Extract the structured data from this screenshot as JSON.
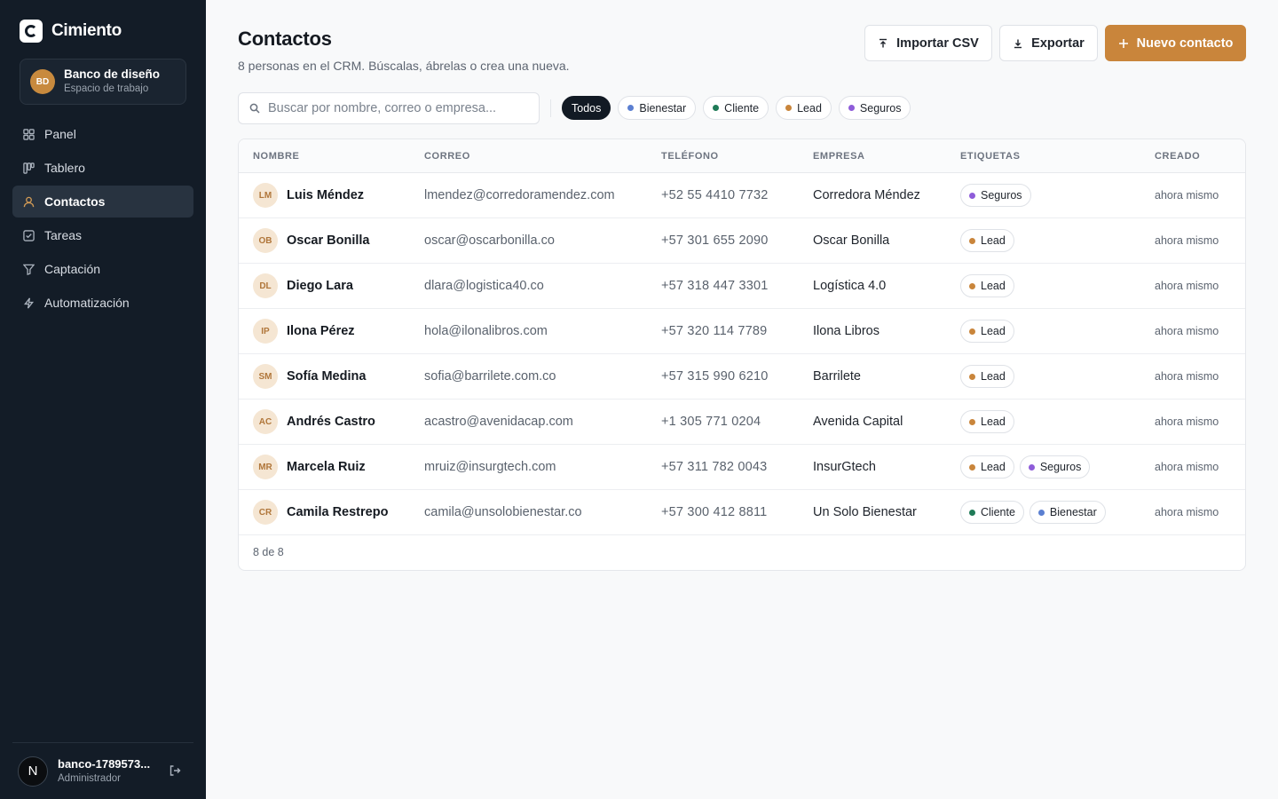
{
  "brand": {
    "name": "Cimiento"
  },
  "workspace": {
    "initials": "BD",
    "name": "Banco de diseño",
    "subtitle": "Espacio de trabajo"
  },
  "nav": [
    {
      "label": "Panel",
      "icon": "grid-icon",
      "active": false
    },
    {
      "label": "Tablero",
      "icon": "kanban-icon",
      "active": false
    },
    {
      "label": "Contactos",
      "icon": "user-icon",
      "active": true
    },
    {
      "label": "Tareas",
      "icon": "checkbox-icon",
      "active": false
    },
    {
      "label": "Captación",
      "icon": "funnel-icon",
      "active": false
    },
    {
      "label": "Automatización",
      "icon": "bolt-icon",
      "active": false
    }
  ],
  "user": {
    "avatar_letter": "N",
    "name": "banco-1789573...",
    "role": "Administrador"
  },
  "header": {
    "title": "Contactos",
    "subtitle": "8 personas en el CRM. Búscalas, ábrelas o crea una nueva.",
    "import_label": "Importar CSV",
    "export_label": "Exportar",
    "new_label": "Nuevo contacto"
  },
  "search": {
    "placeholder": "Buscar por nombre, correo o empresa...",
    "value": ""
  },
  "filters": [
    {
      "label": "Todos",
      "active": true,
      "color": ""
    },
    {
      "label": "Bienestar",
      "active": false,
      "color": "#5b7fd1"
    },
    {
      "label": "Cliente",
      "active": false,
      "color": "#1f7a57"
    },
    {
      "label": "Lead",
      "active": false,
      "color": "#c9853b"
    },
    {
      "label": "Seguros",
      "active": false,
      "color": "#8e5cd9"
    }
  ],
  "table": {
    "columns": [
      "NOMBRE",
      "CORREO",
      "TELÉFONO",
      "EMPRESA",
      "ETIQUETAS",
      "CREADO"
    ],
    "rows": [
      {
        "initials": "LM",
        "name": "Luis Méndez",
        "email": "lmendez@corredoramendez.com",
        "phone": "+52 55 4410 7732",
        "company": "Corredora Méndez",
        "tags": [
          "Seguros"
        ],
        "created": "ahora mismo"
      },
      {
        "initials": "OB",
        "name": "Oscar Bonilla",
        "email": "oscar@oscarbonilla.co",
        "phone": "+57 301 655 2090",
        "company": "Oscar Bonilla",
        "tags": [
          "Lead"
        ],
        "created": "ahora mismo"
      },
      {
        "initials": "DL",
        "name": "Diego Lara",
        "email": "dlara@logistica40.co",
        "phone": "+57 318 447 3301",
        "company": "Logística 4.0",
        "tags": [
          "Lead"
        ],
        "created": "ahora mismo"
      },
      {
        "initials": "IP",
        "name": "Ilona Pérez",
        "email": "hola@ilonalibros.com",
        "phone": "+57 320 114 7789",
        "company": "Ilona Libros",
        "tags": [
          "Lead"
        ],
        "created": "ahora mismo"
      },
      {
        "initials": "SM",
        "name": "Sofía Medina",
        "email": "sofia@barrilete.com.co",
        "phone": "+57 315 990 6210",
        "company": "Barrilete",
        "tags": [
          "Lead"
        ],
        "created": "ahora mismo"
      },
      {
        "initials": "AC",
        "name": "Andrés Castro",
        "email": "acastro@avenidacap.com",
        "phone": "+1 305 771 0204",
        "company": "Avenida Capital",
        "tags": [
          "Lead"
        ],
        "created": "ahora mismo"
      },
      {
        "initials": "MR",
        "name": "Marcela Ruiz",
        "email": "mruiz@insurgtech.com",
        "phone": "+57 311 782 0043",
        "company": "InsurGtech",
        "tags": [
          "Lead",
          "Seguros"
        ],
        "created": "ahora mismo"
      },
      {
        "initials": "CR",
        "name": "Camila Restrepo",
        "email": "camila@unsolobienestar.co",
        "phone": "+57 300 412 8811",
        "company": "Un Solo Bienestar",
        "tags": [
          "Cliente",
          "Bienestar"
        ],
        "created": "ahora mismo"
      }
    ],
    "footer": "8 de 8"
  },
  "tag_colors": {
    "Bienestar": "#5b7fd1",
    "Cliente": "#1f7a57",
    "Lead": "#c9853b",
    "Seguros": "#8e5cd9"
  },
  "colors": {
    "sidebar": "#131c27",
    "accent": "#c9853b"
  }
}
